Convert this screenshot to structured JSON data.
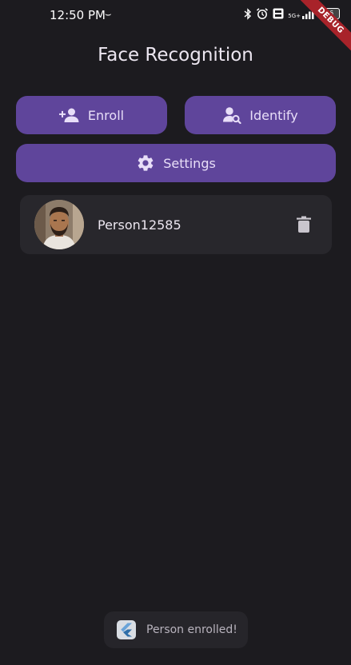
{
  "status_bar": {
    "time": "12:50 PM",
    "mini_glyph": "⌣",
    "network_label": "5G+",
    "battery": "56",
    "icons": [
      "bluetooth-icon",
      "alarm-icon",
      "vo-lte-icon",
      "signal-icon",
      "battery-icon"
    ]
  },
  "debug_banner": "DEBUG",
  "app": {
    "title": "Face Recognition"
  },
  "actions": {
    "enroll_label": "Enroll",
    "identify_label": "Identify",
    "settings_label": "Settings"
  },
  "people": [
    {
      "name": "Person12585"
    }
  ],
  "toast": {
    "message": "Person enrolled!"
  },
  "colors": {
    "background": "#1c1b1f",
    "button": "#5f459b",
    "button_text": "#e8def8",
    "card": "#28272c",
    "debug_ribbon": "#a8232a"
  }
}
